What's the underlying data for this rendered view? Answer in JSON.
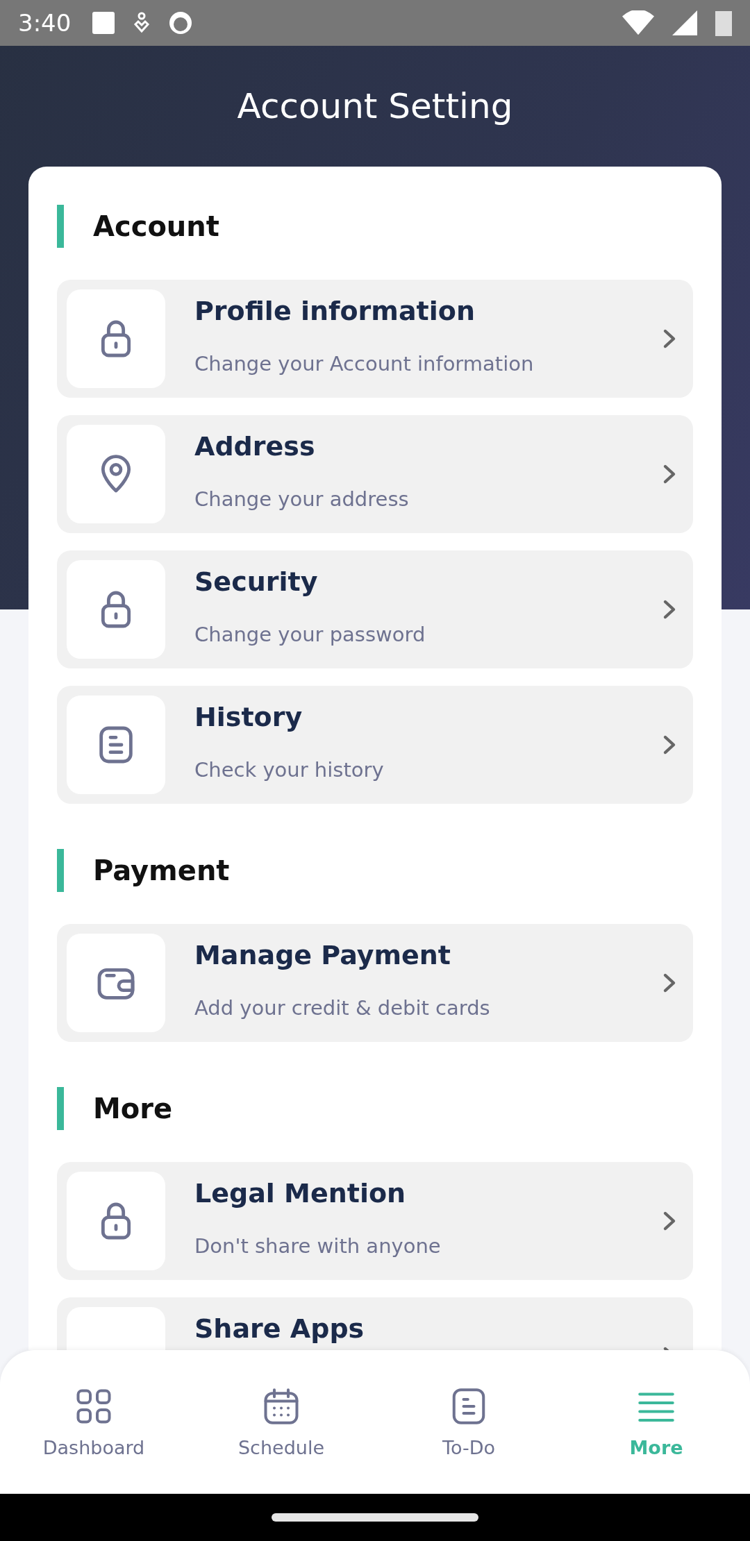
{
  "status_bar": {
    "time": "3:40"
  },
  "title": "Account Setting",
  "sections": [
    {
      "title": "Account",
      "items": [
        {
          "kind": "lock",
          "title": "Profile information",
          "subtitle": "Change your Account information"
        },
        {
          "kind": "pin",
          "title": "Address",
          "subtitle": "Change your address"
        },
        {
          "kind": "lock",
          "title": "Security",
          "subtitle": "Change your password"
        },
        {
          "kind": "list",
          "title": "History",
          "subtitle": "Check your history"
        }
      ]
    },
    {
      "title": "Payment",
      "items": [
        {
          "kind": "wallet",
          "title": "Manage Payment",
          "subtitle": "Add your credit & debit cards"
        }
      ]
    },
    {
      "title": "More",
      "items": [
        {
          "kind": "lock",
          "title": "Legal Mention",
          "subtitle": "Don't share with anyone"
        },
        {
          "title": "Share Apps"
        }
      ]
    }
  ],
  "nav": [
    {
      "kind": "grid",
      "label": "Dashboard",
      "selected": false
    },
    {
      "kind": "calendar",
      "label": "Schedule",
      "selected": false
    },
    {
      "kind": "list",
      "label": "To-Do",
      "selected": false
    },
    {
      "kind": "menu",
      "label": "More",
      "selected": true
    }
  ]
}
